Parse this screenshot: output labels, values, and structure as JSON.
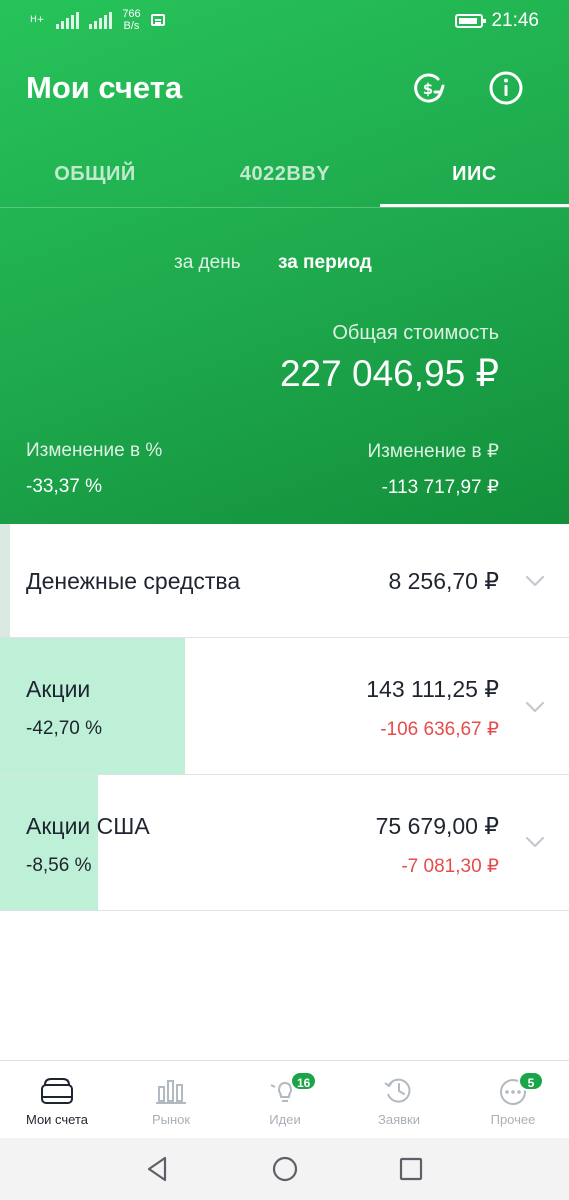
{
  "status_bar": {
    "signal_label": "H+",
    "net_speed_value": "766",
    "net_speed_unit": "B/s",
    "time": "21:46"
  },
  "header": {
    "title": "Мои счета",
    "icons": [
      "currency-exchange-icon",
      "info-icon"
    ]
  },
  "tabs": [
    {
      "label": "ОБЩИЙ",
      "active": false
    },
    {
      "label": "4022BBY",
      "active": false
    },
    {
      "label": "ИИС",
      "active": true
    }
  ],
  "period": {
    "options": [
      "за день",
      "за период"
    ],
    "selected": "за период"
  },
  "summary": {
    "total_label": "Общая стоимость",
    "total_value": "227 046,95 ₽",
    "change_pct_label": "Изменение в  %",
    "change_pct_value": "-33,37  %",
    "change_rub_label": "Изменение в ₽",
    "change_rub_value": "-113 717,97 ₽"
  },
  "assets": [
    {
      "name": "Денежные средства",
      "amount": "8 256,70 ₽",
      "pct": "",
      "delta": "",
      "share": 0.018
    },
    {
      "name": "Акции",
      "amount": "143 111,25 ₽",
      "pct": "-42,70  %",
      "delta": "-106 636,67 ₽",
      "share": 0.325
    },
    {
      "name": "Акции США",
      "amount": "75 679,00 ₽",
      "pct": "-8,56  %",
      "delta": "-7 081,30 ₽",
      "share": 0.172
    }
  ],
  "bottom_nav": [
    {
      "label": "Мои счета",
      "icon": "wallet-icon",
      "active": true,
      "badge": ""
    },
    {
      "label": "Рынок",
      "icon": "market-chart-icon",
      "active": false,
      "badge": ""
    },
    {
      "label": "Идеи",
      "icon": "lightbulb-icon",
      "active": false,
      "badge": "16"
    },
    {
      "label": "Заявки",
      "icon": "history-clock-icon",
      "active": false,
      "badge": ""
    },
    {
      "label": "Прочее",
      "icon": "more-dots-icon",
      "active": false,
      "badge": "5"
    }
  ],
  "colors": {
    "header_green": "#1ea84c",
    "negative_red": "#e54d4d",
    "bar_mint": "#bdf0d6",
    "badge_green": "#1aa548"
  }
}
